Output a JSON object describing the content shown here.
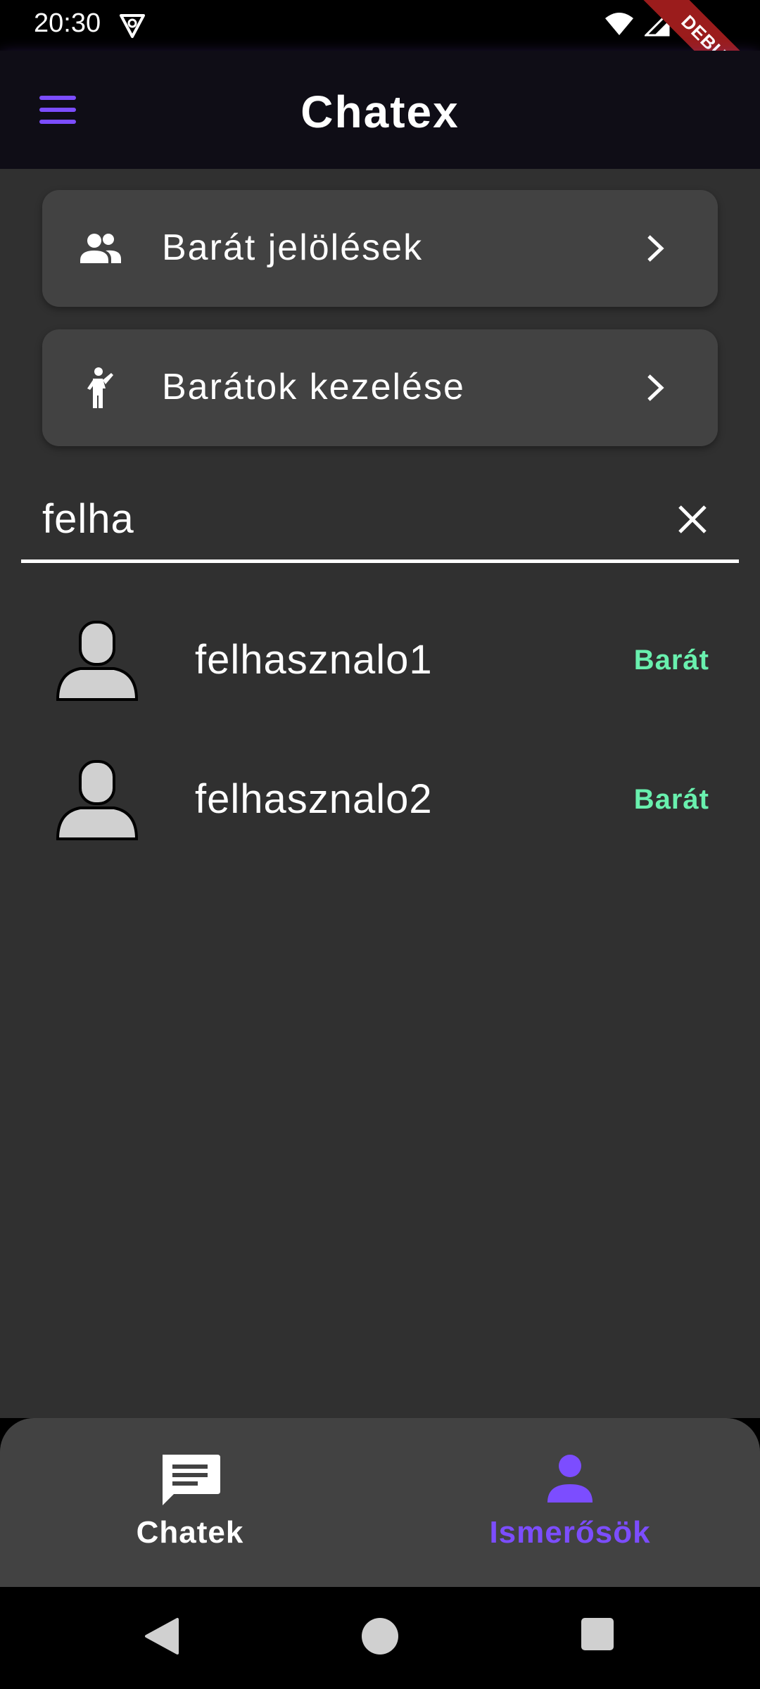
{
  "status_bar": {
    "time": "20:30",
    "debug_label": "DEBUG"
  },
  "app_bar": {
    "title": "Chatex"
  },
  "nav_cards": [
    {
      "label": "Barát jelölések",
      "icon": "people-icon"
    },
    {
      "label": "Barátok kezelése",
      "icon": "person-waving-icon"
    }
  ],
  "search": {
    "value": "felha",
    "placeholder": ""
  },
  "results": [
    {
      "username": "felhasznalo1",
      "status": "Barát"
    },
    {
      "username": "felhasznalo2",
      "status": "Barát"
    }
  ],
  "bottom_nav": {
    "items": [
      {
        "label": "Chatek",
        "icon": "chat-icon",
        "active": false
      },
      {
        "label": "Ismerősök",
        "icon": "person-icon",
        "active": true
      }
    ]
  },
  "colors": {
    "accent": "#7c4dff",
    "friend_status": "#69f0ae",
    "background": "#303030",
    "card": "#424242",
    "app_bar": "#0f0d16"
  }
}
